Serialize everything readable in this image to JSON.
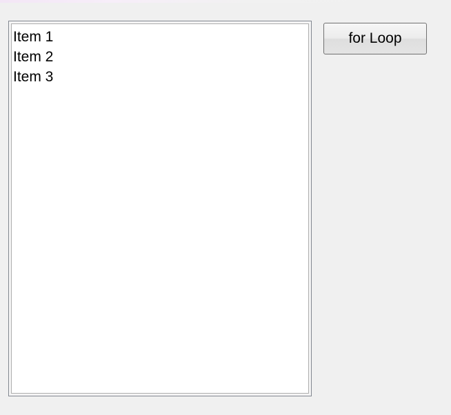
{
  "listbox": {
    "items": [
      {
        "label": "Item 1"
      },
      {
        "label": "Item 2"
      },
      {
        "label": "Item 3"
      }
    ]
  },
  "button": {
    "label": "for Loop"
  },
  "colors": {
    "window_background": "#f0f0f0",
    "listbox_background": "#ffffff",
    "listbox_border": "#828790",
    "button_border": "#707070",
    "text": "#000000"
  }
}
